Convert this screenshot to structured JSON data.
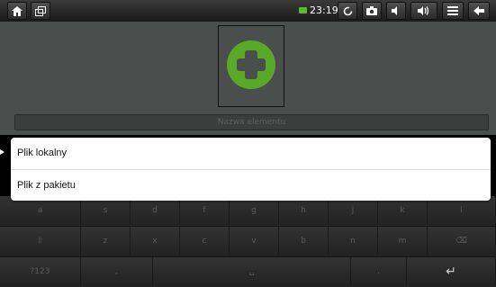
{
  "status_bar": {
    "time": "23:19",
    "icons": [
      "home-icon",
      "recent-apps-icon",
      "battery-icon",
      "refresh-icon",
      "camera-icon",
      "volume-down-icon",
      "volume-up-icon",
      "menu-icon",
      "back-icon"
    ]
  },
  "app": {
    "name_placeholder": "Nazwa elementu",
    "icon": "green-cross-icon",
    "colors": {
      "icon_green": "#5aa82a",
      "background": "#4a4e4d"
    }
  },
  "popup": {
    "items": [
      "Plik lokalny",
      "Plik z pakietu"
    ]
  },
  "keyboard": {
    "row1": [
      "a",
      "s",
      "d",
      "f",
      "g",
      "h",
      "j",
      "k",
      "l"
    ],
    "row2": [
      "⇧",
      "z",
      "x",
      "c",
      "v",
      "b",
      "n",
      "m",
      "⌫"
    ],
    "row3": [
      "?123",
      ",",
      "␣",
      ".",
      "↵"
    ]
  }
}
